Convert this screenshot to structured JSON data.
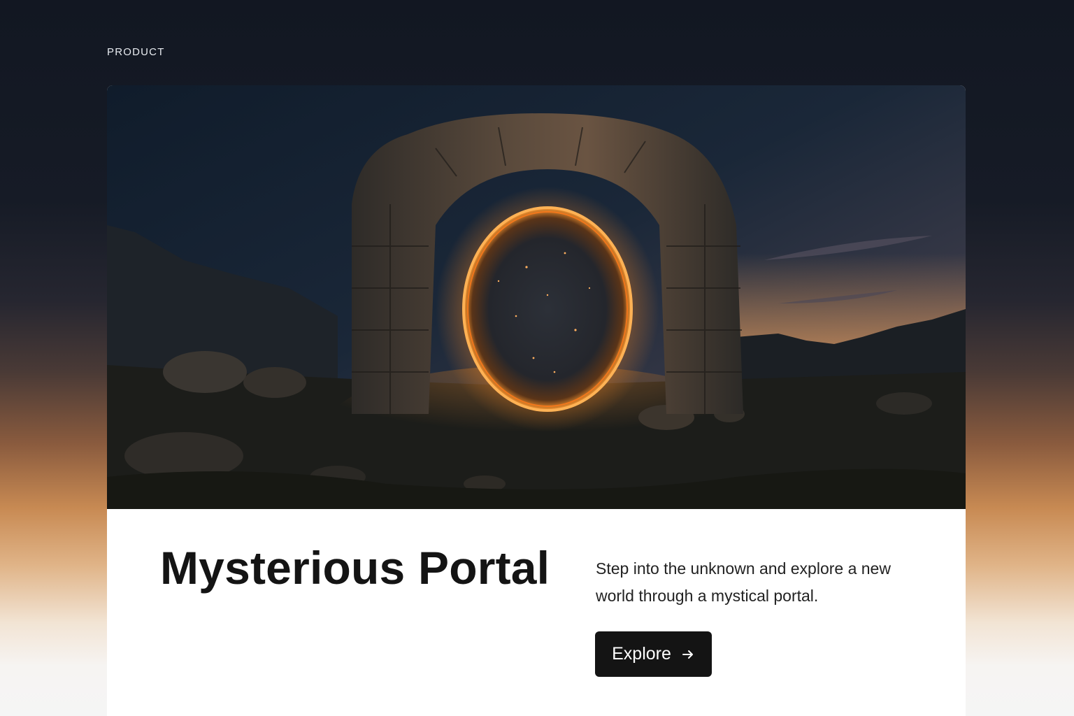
{
  "eyebrow": "PRODUCT",
  "product": {
    "title": "Mysterious Portal",
    "description": "Step into the unknown and explore a new world through a mystical portal.",
    "cta_label": "Explore",
    "cta_icon": "arrow-right-icon"
  },
  "hero_image": {
    "subject": "glowing orange portal in a stone arch at dusk"
  },
  "colors": {
    "portal_glow": "#ff9a30",
    "button_bg": "#141414",
    "card_bg": "#ffffff"
  }
}
